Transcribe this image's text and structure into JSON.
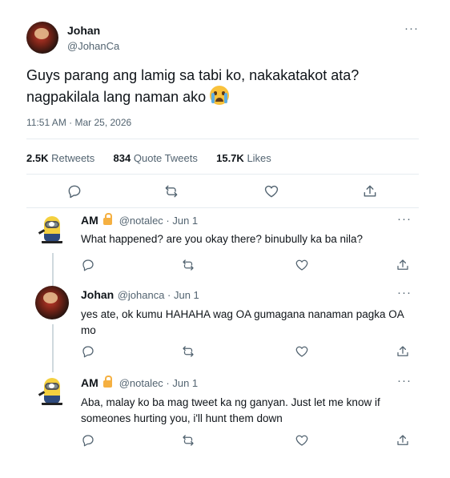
{
  "tweet": {
    "author_name": "Johan",
    "author_handle": "@JohanCa",
    "text": "Guys parang ang lamig sa tabi ko, nakakatakot ata? nagpakilala lang naman ako",
    "emoji": "loudly-crying-face",
    "timestamp": "11:51 AM · Mar 25, 2026",
    "more": "···",
    "stats": {
      "retweets_count": "2.5K",
      "retweets_label": "Retweets",
      "quotes_count": "834",
      "quotes_label": "Quote Tweets",
      "likes_count": "15.7K",
      "likes_label": "Likes"
    }
  },
  "replies": [
    {
      "name": "AM",
      "locked": true,
      "handle_date": "@notalec · Jun 1",
      "text": "What happened? are you okay there? binubully ka ba nila?",
      "avatar": "minion-avatar"
    },
    {
      "name": "Johan",
      "locked": false,
      "handle_date": "@johanca · Jun 1",
      "text": "yes ate, ok kumu HAHAHA wag OA gumagana nanaman pagka OA mo",
      "avatar": "johan-avatar"
    },
    {
      "name": "AM",
      "locked": true,
      "handle_date": "@notalec · Jun 1",
      "text": "Aba, malay ko ba mag tweet ka ng ganyan. Just let me know if someones hurting you, i'll hunt them down",
      "avatar": "minion-avatar"
    }
  ],
  "icons": {
    "reply": "reply-icon",
    "retweet": "retweet-icon",
    "like": "heart-icon",
    "share": "share-icon"
  },
  "colors": {
    "text": "#0f1419",
    "secondary": "#536471",
    "divider": "#e6ecf0",
    "thread_line": "#cfd9de"
  }
}
